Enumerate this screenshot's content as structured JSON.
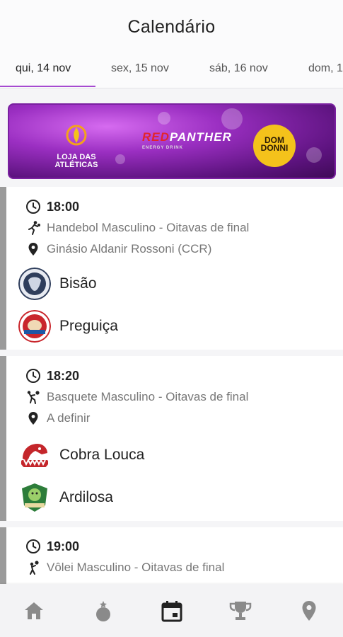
{
  "header": {
    "title": "Calendário"
  },
  "tabs": [
    {
      "label": "qui, 14 nov",
      "active": true
    },
    {
      "label": "sex, 15 nov",
      "active": false
    },
    {
      "label": "sáb, 16 nov",
      "active": false
    },
    {
      "label": "dom, 1",
      "active": false
    }
  ],
  "banner": {
    "sponsor1_line1": "LOJA DAS",
    "sponsor1_line2": "ATLÉTICAS",
    "sponsor2_prefix": "RED",
    "sponsor2_name": "PANTHER",
    "sponsor2_sub": "ENERGY DRINK",
    "sponsor3_line1": "DOM",
    "sponsor3_line2": "DONNI"
  },
  "matches": [
    {
      "time": "18:00",
      "sport": "Handebol Masculino - Oitavas de final",
      "sport_icon": "handball-icon",
      "venue": "Ginásio Aldanir Rossoni (CCR)",
      "teams": [
        {
          "name": "Bisão",
          "logo_color": "#2f3e5c"
        },
        {
          "name": "Preguiça",
          "logo_color": "#c9262c"
        }
      ]
    },
    {
      "time": "18:20",
      "sport": "Basquete Masculino - Oitavas de final",
      "sport_icon": "basketball-icon",
      "venue": "A definir",
      "teams": [
        {
          "name": "Cobra Louca",
          "logo_color": "#c4262b"
        },
        {
          "name": "Ardilosa",
          "logo_color": "#2d7d3a"
        }
      ]
    },
    {
      "time": "19:00",
      "sport": "Vôlei Masculino - Oitavas de final",
      "sport_icon": "volleyball-icon",
      "venue": "",
      "teams": []
    }
  ],
  "bottom_nav": [
    {
      "icon": "home-icon",
      "active": false
    },
    {
      "icon": "medal-icon",
      "active": false
    },
    {
      "icon": "calendar-icon",
      "active": true
    },
    {
      "icon": "trophy-icon",
      "active": false
    },
    {
      "icon": "location-icon",
      "active": false
    }
  ],
  "colors": {
    "accent": "#a64ad0",
    "card_border": "#9b9b9b",
    "nav_inactive": "#8a8a8a",
    "nav_active": "#222222"
  }
}
